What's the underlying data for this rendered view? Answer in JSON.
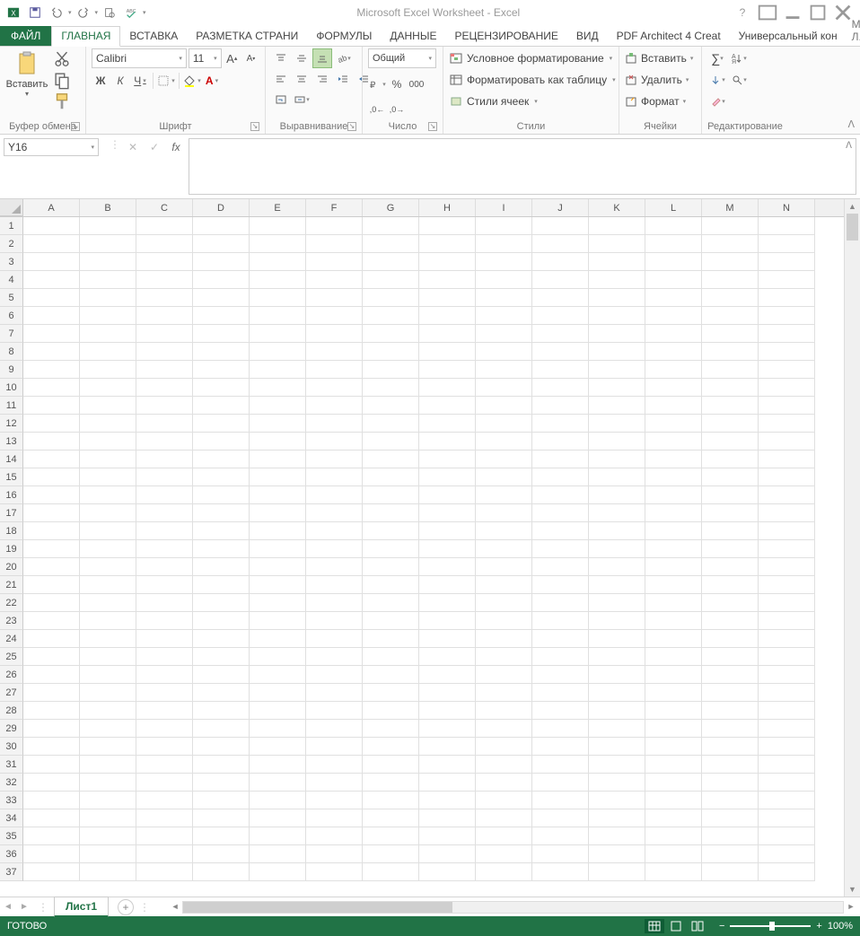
{
  "title": "Microsoft Excel Worksheet - Excel",
  "user_name": "Мария Л...",
  "tabs": {
    "file": "ФАЙЛ",
    "home": "ГЛАВНАЯ",
    "insert": "ВСТАВКА",
    "page_layout": "РАЗМЕТКА СТРАНИ",
    "formulas": "ФОРМУЛЫ",
    "data": "ДАННЫЕ",
    "review": "РЕЦЕНЗИРОВАНИЕ",
    "view": "ВИД",
    "pdf": "PDF Architect 4 Creat",
    "universal": "Универсальный кон"
  },
  "ribbon": {
    "clipboard": {
      "label": "Буфер обмена",
      "paste": "Вставить"
    },
    "font": {
      "label": "Шрифт",
      "name": "Calibri",
      "size": "11",
      "bold": "Ж",
      "italic": "К",
      "underline": "Ч"
    },
    "alignment": {
      "label": "Выравнивание"
    },
    "number": {
      "label": "Число",
      "format": "Общий"
    },
    "styles": {
      "label": "Стили",
      "cond": "Условное форматирование",
      "table": "Форматировать как таблицу",
      "cells": "Стили ячеек"
    },
    "cells": {
      "label": "Ячейки",
      "insert": "Вставить",
      "delete": "Удалить",
      "format": "Формат"
    },
    "editing": {
      "label": "Редактирование"
    }
  },
  "namebox": "Y16",
  "columns": [
    "A",
    "B",
    "C",
    "D",
    "E",
    "F",
    "G",
    "H",
    "I",
    "J",
    "K",
    "L",
    "M",
    "N"
  ],
  "rows": [
    1,
    2,
    3,
    4,
    5,
    6,
    7,
    8,
    9,
    10,
    11,
    12,
    13,
    14,
    15,
    16,
    17,
    18,
    19,
    20,
    21,
    22,
    23,
    24,
    25,
    26,
    27,
    28,
    29,
    30,
    31,
    32,
    33,
    34,
    35,
    36,
    37
  ],
  "sheet": "Лист1",
  "status": {
    "ready": "ГОТОВО",
    "zoom": "100%"
  }
}
